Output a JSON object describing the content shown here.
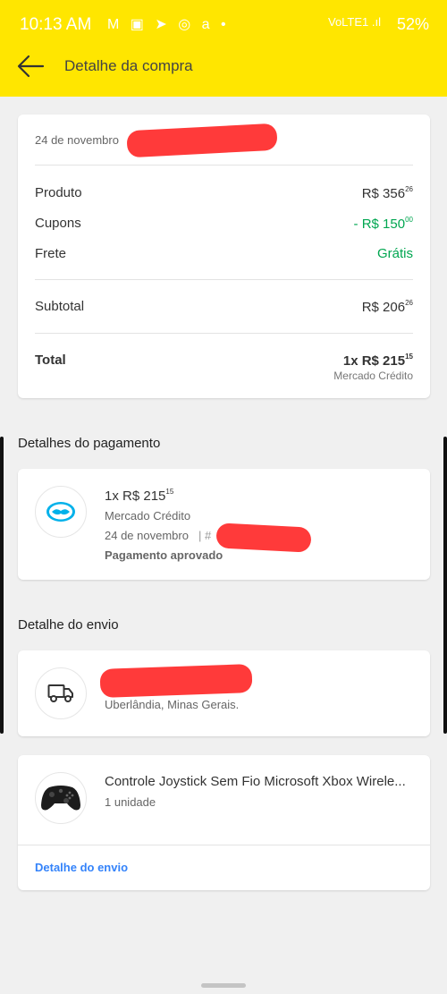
{
  "status_bar": {
    "time": "10:13 AM",
    "notification_icons": "M ▣ ➤ ◎ a •",
    "signal": "VoLTE1 .ıl",
    "battery": "52%"
  },
  "header": {
    "title": "Detalhe da compra",
    "background": "#ffe600"
  },
  "summary": {
    "date": "24 de novembro",
    "product_label": "Produto",
    "product_value": "R$ 356",
    "product_cents": "26",
    "coupons_label": "Cupons",
    "coupons_value": "- R$ 150",
    "coupons_cents": "00",
    "shipping_label": "Frete",
    "shipping_value": "Grátis",
    "subtotal_label": "Subtotal",
    "subtotal_value": "R$ 206",
    "subtotal_cents": "26",
    "total_label": "Total",
    "total_value": "1x R$ 215",
    "total_cents": "15",
    "total_method": "Mercado Crédito"
  },
  "payment": {
    "section_title": "Detalhes do pagamento",
    "amount": "1x R$ 215",
    "amount_cents": "15",
    "method": "Mercado Crédito",
    "date": "24 de novembro",
    "separator": "|  #",
    "status": "Pagamento aprovado"
  },
  "shipping": {
    "section_title": "Detalhe do envio",
    "location": "Uberlândia, Minas Gerais."
  },
  "item": {
    "name": "Controle Joystick Sem Fio Microsoft Xbox Wirele...",
    "quantity": "1 unidade",
    "link": "Detalhe do envio"
  },
  "colors": {
    "accent_green": "#00a650",
    "link_blue": "#3483fa",
    "redaction": "#ff3a3a"
  }
}
